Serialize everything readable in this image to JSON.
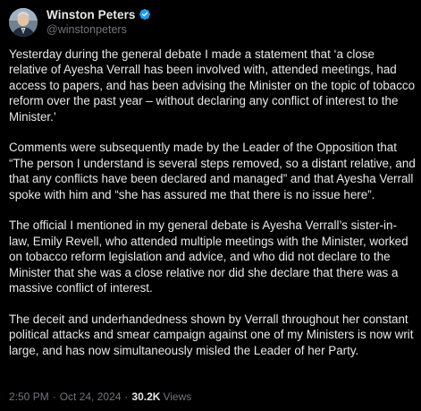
{
  "author": {
    "display_name": "Winston Peters",
    "handle": "@winstonpeters",
    "verified_icon": "verified-badge-icon",
    "verified_color": "#1d9bf0"
  },
  "tweet": {
    "paragraphs": [
      "Yesterday during the general debate I made a statement that ‘a close relative of Ayesha Verrall has been involved with, attended meetings, had access to papers, and has been advising the Minister on the topic of tobacco reform over the past year – without declaring any conflict of interest to the Minister.’",
      "Comments were subsequently made by the Leader of the Opposition that “The person I understand is several steps removed, so a distant relative, and that any conflicts have been declared and managed” and that Ayesha Verrall spoke with him and “she has assured me that there is no issue here”.",
      "The official I mentioned in my general debate is Ayesha Verrall’s sister-in-law, Emily Revell, who attended multiple meetings with the Minister, worked on tobacco reform legislation and advice, and who did not declare to the Minister that she was a close relative nor did she declare that there was a massive conflict of interest.",
      "The deceit and underhandedness shown by Verrall throughout her constant political attacks and smear campaign against one of my Ministers is now writ large, and has now simultaneously misled the Leader of her Party."
    ],
    "time": "2:50 PM",
    "separator_1": "·",
    "date": "Oct 24, 2024",
    "separator_2": "·",
    "views_count": "30.2K",
    "views_label": "Views"
  },
  "colors": {
    "background": "#000000",
    "text_primary": "#e7e9ea",
    "text_secondary": "#71767b"
  }
}
